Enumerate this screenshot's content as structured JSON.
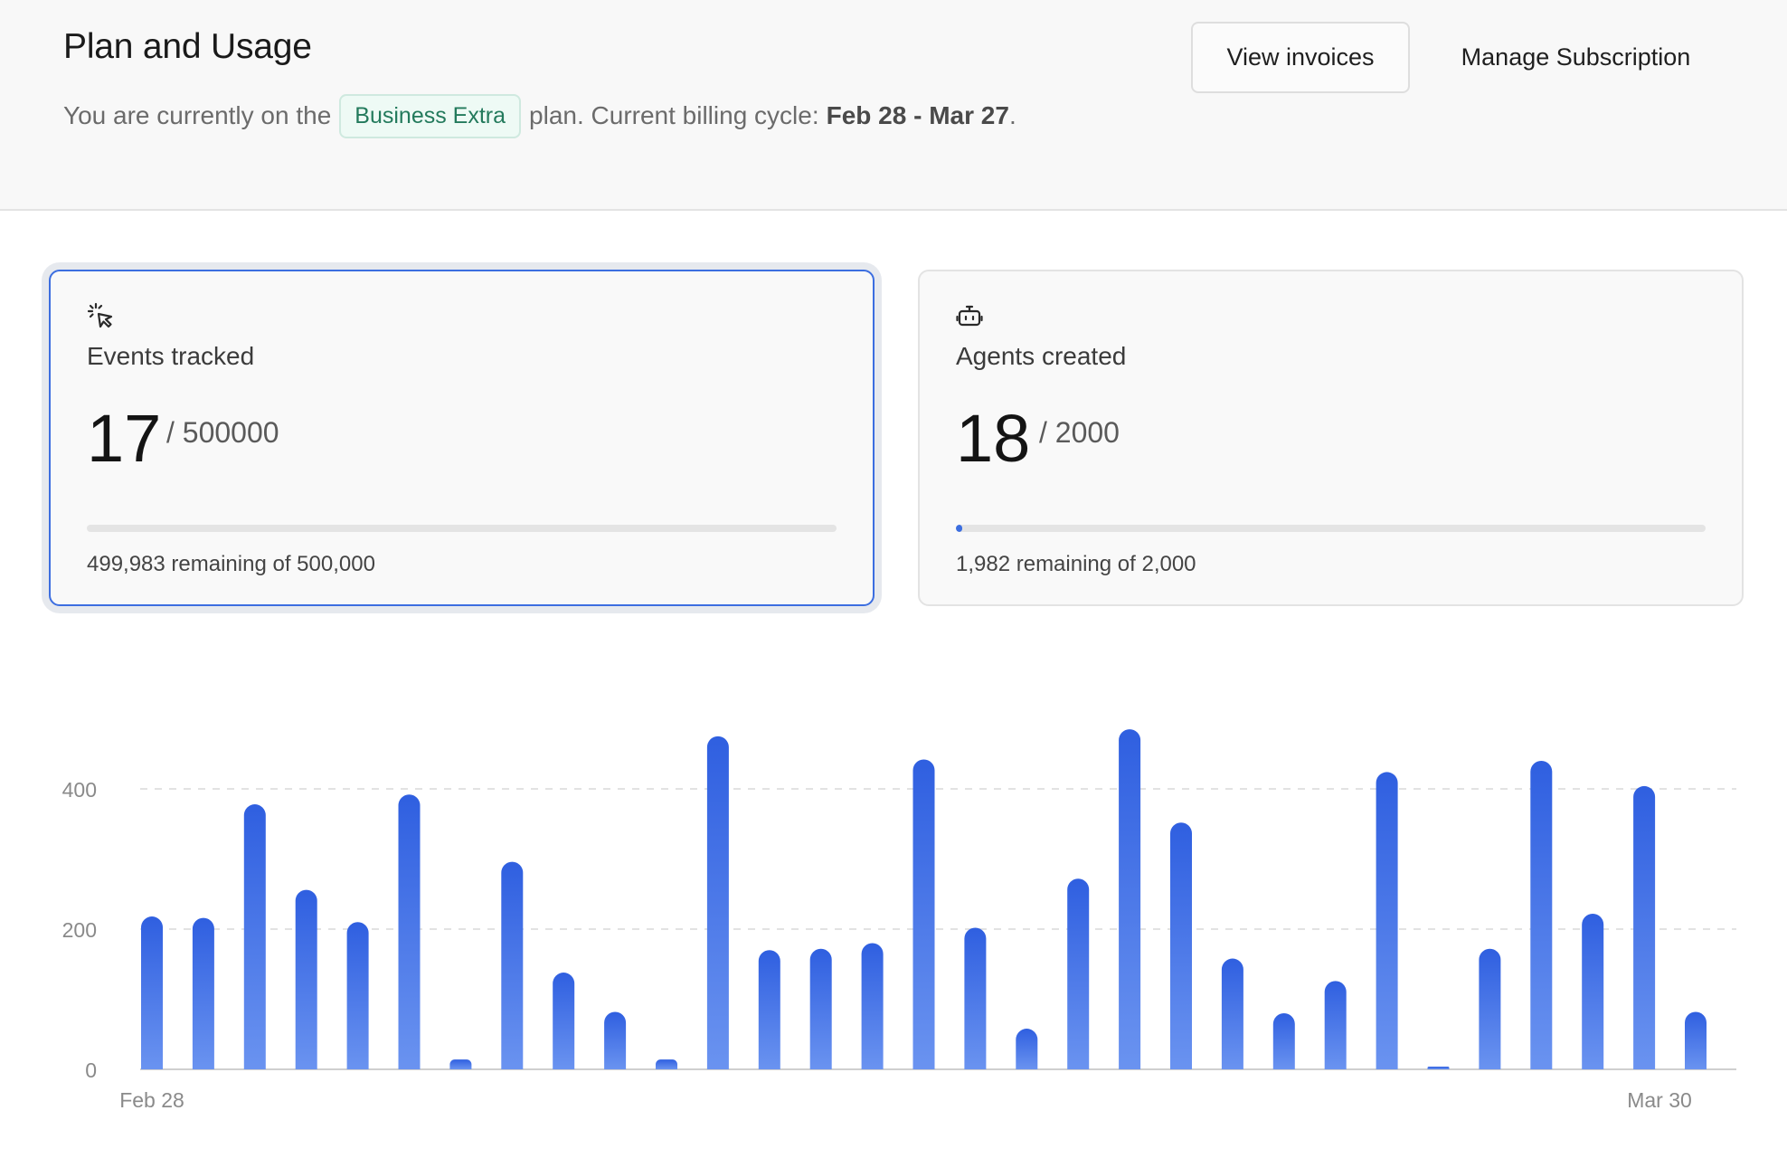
{
  "header": {
    "title": "Plan and Usage",
    "plan_prefix": "You are currently on the",
    "plan_name": "Business Extra",
    "plan_suffix": "plan. Current billing cycle:",
    "billing_cycle": "Feb 28 - Mar 27",
    "period": ".",
    "view_invoices_label": "View invoices",
    "manage_subscription_label": "Manage Subscription"
  },
  "cards": [
    {
      "icon": "cursor-click-icon",
      "label": "Events tracked",
      "value": "17",
      "limit": "/ 500000",
      "usage_fraction": 3.4e-05,
      "remaining": "499,983 remaining of 500,000",
      "selected": true
    },
    {
      "icon": "robot-icon",
      "label": "Agents created",
      "value": "18",
      "limit": "/ 2000",
      "usage_fraction": 0.009,
      "remaining": "1,982 remaining of 2,000",
      "selected": false
    }
  ],
  "colors": {
    "accent": "#3c6ee0",
    "bar_top": "#2f5fe0",
    "bar_bottom": "#6a93f0",
    "badge_text": "#237a5c",
    "badge_bg": "#eefaf5"
  },
  "chart_data": {
    "type": "bar",
    "x_tick_labels": [
      "Feb 28",
      "Mar 30"
    ],
    "y_ticks": [
      0,
      200,
      400
    ],
    "ylim": [
      0,
      500
    ],
    "grid": true,
    "values": [
      218,
      216,
      378,
      256,
      210,
      392,
      14,
      296,
      138,
      82,
      14,
      475,
      170,
      172,
      180,
      442,
      202,
      58,
      272,
      485,
      352,
      158,
      80,
      126,
      424,
      2,
      172,
      440,
      222,
      404,
      82
    ]
  }
}
